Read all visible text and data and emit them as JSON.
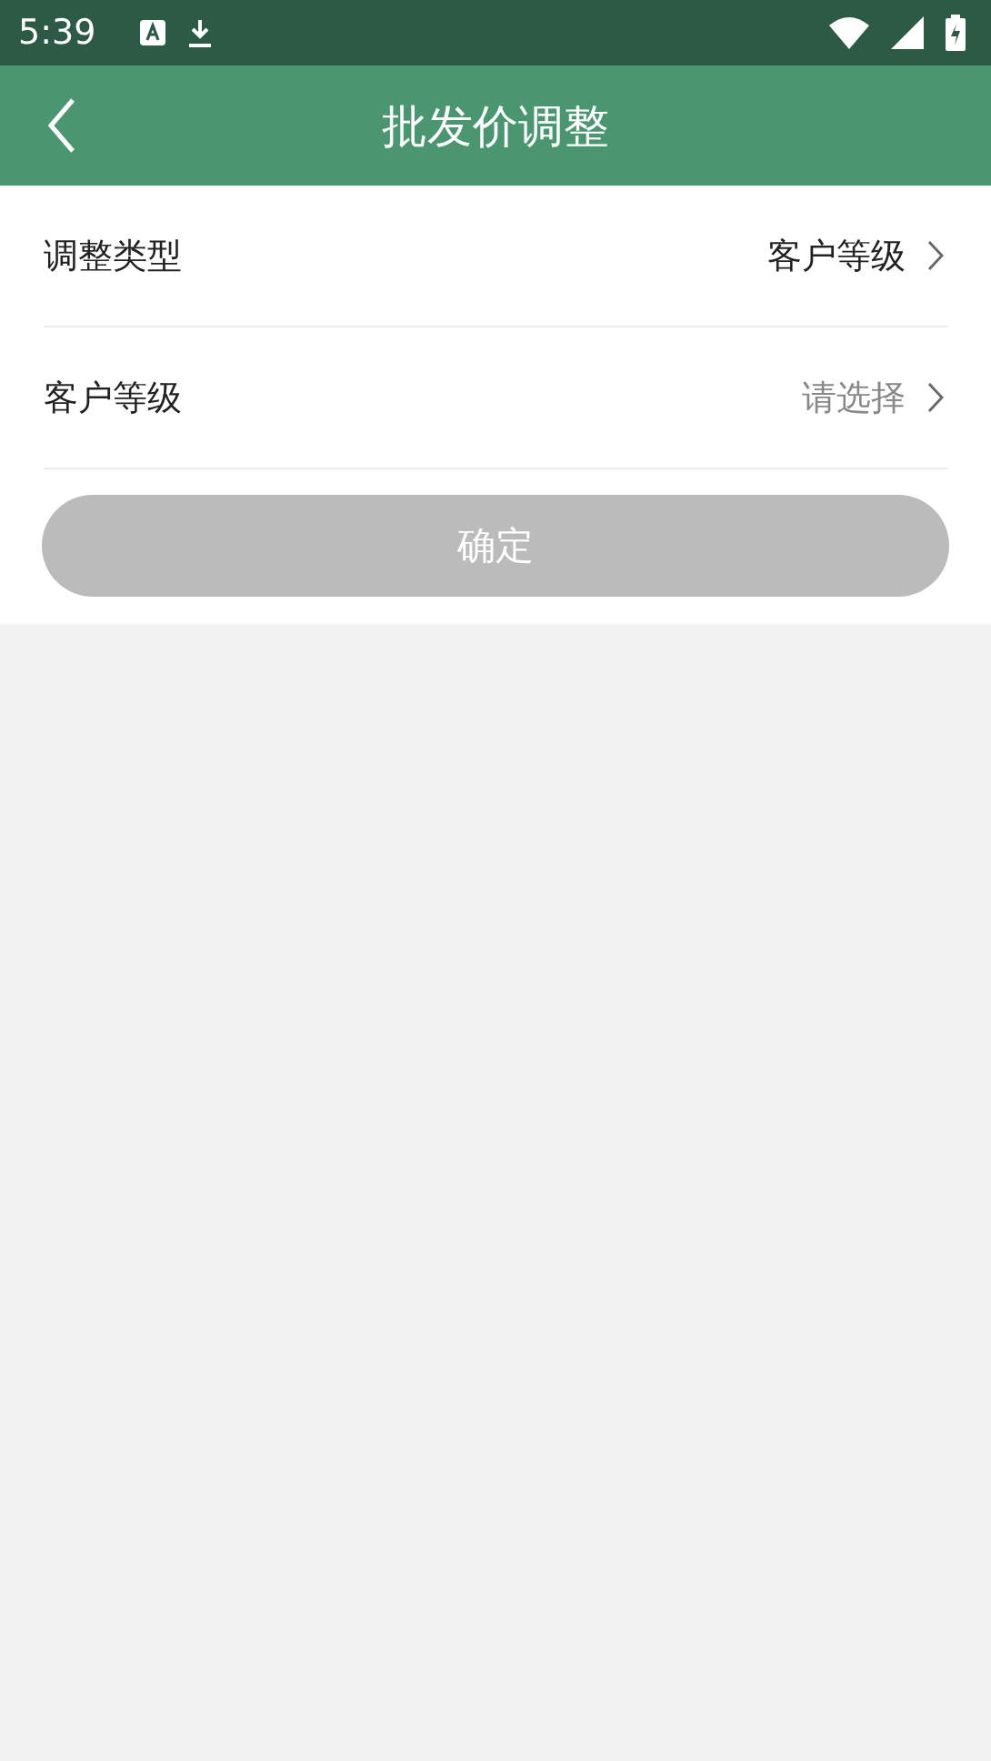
{
  "status_bar": {
    "time": "5:39"
  },
  "header": {
    "title": "批发价调整"
  },
  "rows": [
    {
      "label": "调整类型",
      "value": "客户等级"
    },
    {
      "label": "客户等级",
      "placeholder": "请选择"
    }
  ],
  "confirm_button": {
    "label": "确定",
    "disabled": true
  }
}
